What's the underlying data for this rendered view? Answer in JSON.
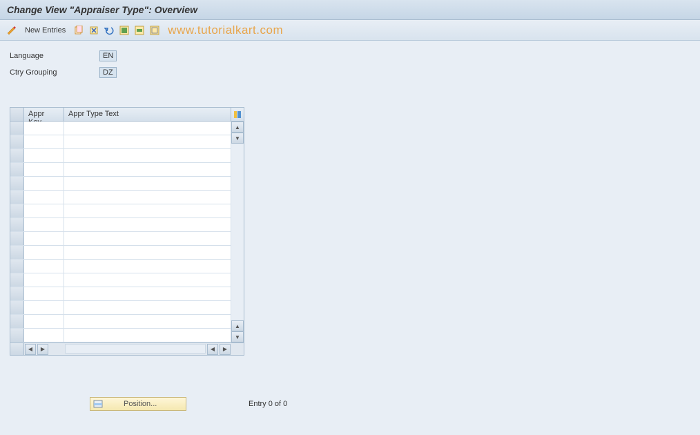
{
  "title": "Change View \"Appraiser Type\": Overview",
  "toolbar": {
    "new_entries_label": "New Entries"
  },
  "watermark": "www.tutorialkart.com",
  "form": {
    "language_label": "Language",
    "language_value": "EN",
    "ctry_grouping_label": "Ctry Grouping",
    "ctry_grouping_value": "DZ"
  },
  "table": {
    "col_appr_key": "Appr Key",
    "col_appr_type_text": "Appr Type Text",
    "row_count": 16
  },
  "footer": {
    "position_label": "Position...",
    "entry_text": "Entry 0 of 0"
  }
}
